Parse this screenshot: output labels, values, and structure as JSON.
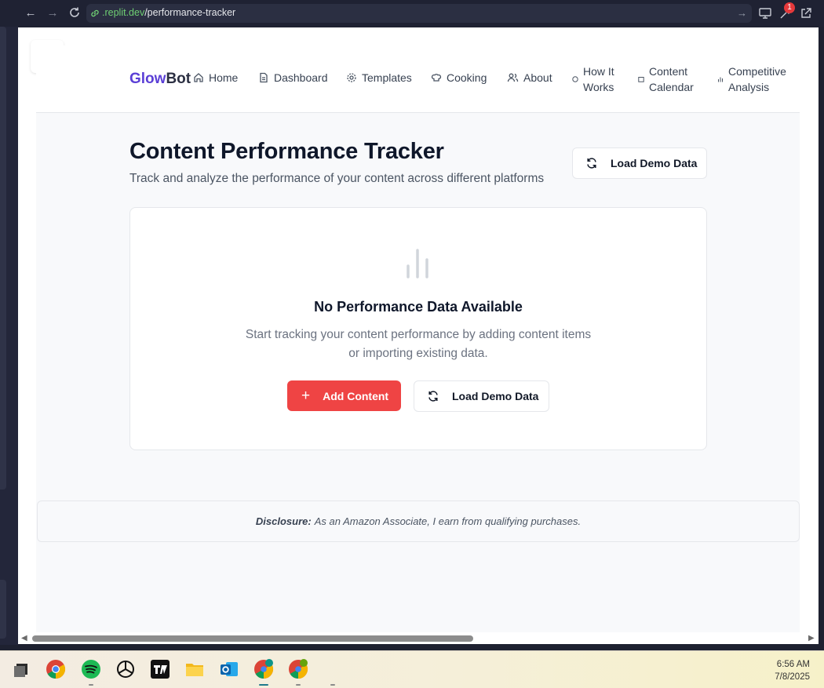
{
  "browser": {
    "url_host": ".replit.dev",
    "url_path": "/performance-tracker",
    "notification_count": "1"
  },
  "nav": {
    "logo_part1": "Glow",
    "logo_part2": "Bot",
    "items": [
      {
        "label": "Home",
        "icon": "home-icon"
      },
      {
        "label": "Dashboard",
        "icon": "document-icon"
      },
      {
        "label": "Templates",
        "icon": "gear-icon"
      },
      {
        "label": "Cooking",
        "icon": "chef-hat-icon"
      },
      {
        "label": "About",
        "icon": "users-icon"
      },
      {
        "label_line1": "How It",
        "label_line2": "Works",
        "icon": "help-circle-icon"
      },
      {
        "label_line1": "Content",
        "label_line2": "Calendar",
        "icon": "calendar-icon"
      },
      {
        "label_line1": "Competitive",
        "label_line2": "Analysis",
        "icon": "bar-chart-icon"
      }
    ]
  },
  "page": {
    "title": "Content Performance Tracker",
    "subtitle": "Track and analyze the performance of your content across different platforms",
    "load_demo_label": "Load Demo Data"
  },
  "empty_state": {
    "title": "No Performance Data Available",
    "description": "Start tracking your content performance by adding content items or importing existing data.",
    "add_label": "Add Content",
    "load_demo_label": "Load Demo Data"
  },
  "footer": {
    "disclosure_label": "Disclosure:",
    "disclosure_text": "As an Amazon Associate, I earn from qualifying purchases."
  },
  "taskbar": {
    "time": "6:56 AM",
    "date": "7/8/2025",
    "apps": [
      "task-view-icon",
      "chrome-icon",
      "spotify-icon",
      "chatgpt-icon",
      "tradingview-icon",
      "file-explorer-icon",
      "outlook-icon",
      "chrome-profile-icon",
      "chrome-profile-icon"
    ]
  },
  "colors": {
    "brand_glow": "#5b3fd6",
    "primary_button": "#ef4444",
    "url_host": "#6fcf73"
  }
}
